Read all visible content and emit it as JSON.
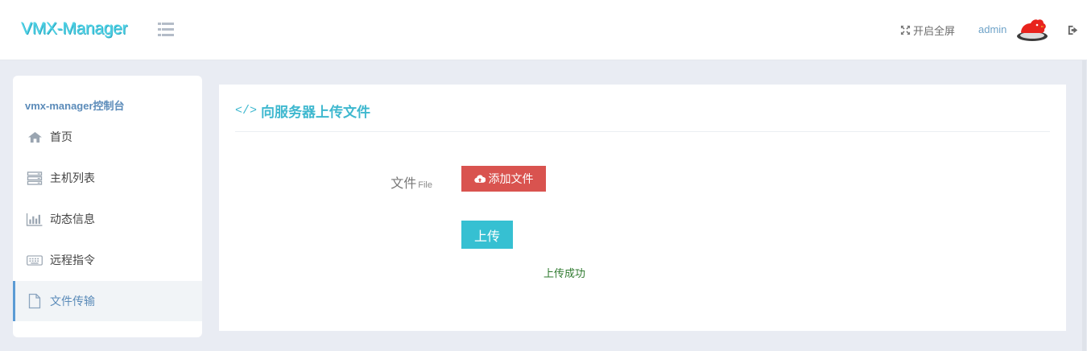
{
  "header": {
    "brand": "VMX-Manager",
    "menu_toggle_icon": "list-icon",
    "fullscreen_label": "开启全屏",
    "fullscreen_icon": "expand-icon",
    "user_name": "admin",
    "avatar_icon": "bird-avatar-icon",
    "logout_icon": "sign-out-icon"
  },
  "sidebar": {
    "title": "vmx-manager控制台",
    "items": [
      {
        "label": "首页",
        "icon": "home-icon",
        "active": false
      },
      {
        "label": "主机列表",
        "icon": "server-icon",
        "active": false
      },
      {
        "label": "动态信息",
        "icon": "bar-chart-icon",
        "active": false
      },
      {
        "label": "远程指令",
        "icon": "keyboard-icon",
        "active": false
      },
      {
        "label": "文件传输",
        "icon": "file-icon",
        "active": true
      }
    ]
  },
  "main": {
    "title_icon": "</>",
    "title": "向服务器上传文件",
    "file_label": "文件",
    "file_label_sub": "File",
    "add_file_button": "添加文件",
    "add_file_icon": "cloud-upload-icon",
    "upload_button": "上传",
    "status_message": "上传成功"
  },
  "colors": {
    "brand": "#4fd3e6",
    "accent": "#3fb8cf",
    "danger_button": "#d9534f",
    "upload_button": "#36c0d2",
    "success_text": "#2f7a2f",
    "sidebar_active_border": "#5b9bd5"
  }
}
